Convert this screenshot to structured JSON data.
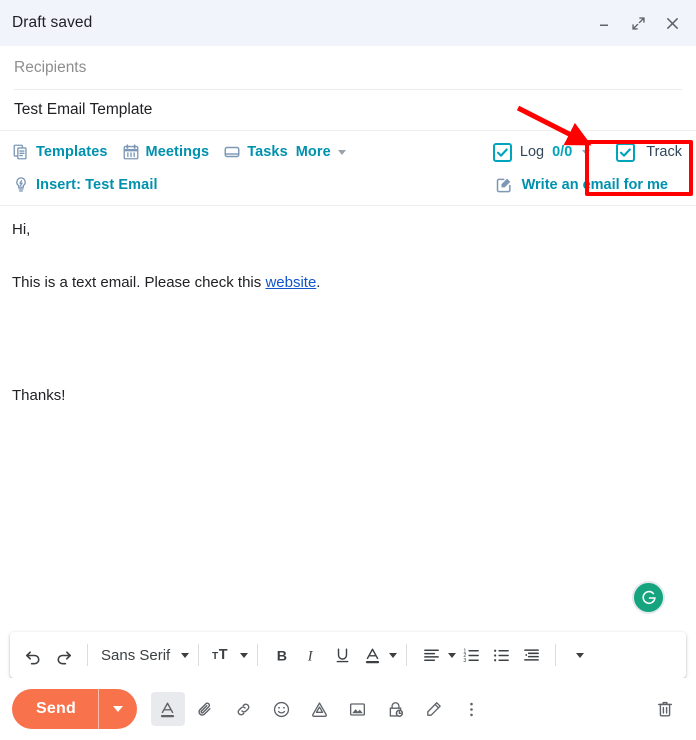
{
  "window": {
    "title": "Draft saved",
    "controls": [
      {
        "name": "minimize",
        "icon": "minimize-icon"
      },
      {
        "name": "fullscreen",
        "icon": "fullscreen-icon"
      },
      {
        "name": "close",
        "icon": "close-icon"
      }
    ]
  },
  "fields": {
    "recipients_placeholder": "Recipients",
    "subject_value": "Test Email Template"
  },
  "plugin_bar": {
    "items": [
      {
        "label": "Templates",
        "icon": "templates-icon"
      },
      {
        "label": "Meetings",
        "icon": "calendar-icon"
      },
      {
        "label": "Tasks",
        "icon": "tasks-icon"
      },
      {
        "label": "More",
        "icon": "chevron-down-icon"
      }
    ],
    "insert": {
      "label": "Insert: Test Email",
      "icon": "lightbulb-icon"
    },
    "log": {
      "label": "Log",
      "count": "0/0",
      "checked": true
    },
    "track": {
      "label": "Track",
      "checked": true
    },
    "write_for_me": {
      "label": "Write an email for me",
      "icon": "compose-square-icon"
    },
    "accent_color": "#0091ae",
    "checkbox_color": "#00a4bd"
  },
  "body": {
    "greeting": "Hi,",
    "sentence_before_link": "This is a text email. Please check this ",
    "link_text": "website",
    "sentence_after_link": ".",
    "closing": "Thanks!",
    "link_color": "#1155cc"
  },
  "grammarly": {
    "name": "grammarly-icon",
    "letter": "G",
    "color": "#15a47e"
  },
  "format_toolbar": {
    "undo": "undo-icon",
    "redo": "redo-icon",
    "font_family": "Sans Serif",
    "font_size": "font-size-icon",
    "bold": "B",
    "italic": "I",
    "underline": "U",
    "text_color": "A",
    "align": "align-left-icon",
    "numbered_list": "numbered-list-icon",
    "bulleted_list": "bulleted-list-icon",
    "indent_less": "indent-less-icon",
    "more": "chevron-down-icon"
  },
  "action_bar": {
    "send_label": "Send",
    "send_color": "#f8724c",
    "icons": [
      {
        "name": "formatting-options-icon",
        "active": true
      },
      {
        "name": "attach-file-icon",
        "active": false
      },
      {
        "name": "insert-link-icon",
        "active": false
      },
      {
        "name": "insert-emoji-icon",
        "active": false
      },
      {
        "name": "insert-drive-icon",
        "active": false
      },
      {
        "name": "insert-photo-icon",
        "active": false
      },
      {
        "name": "confidential-mode-icon",
        "active": false
      },
      {
        "name": "insert-signature-icon",
        "active": false
      },
      {
        "name": "more-options-icon",
        "active": false
      }
    ],
    "discard": "discard-draft-icon"
  },
  "annotations": {
    "highlight_color": "#ff0000",
    "box_target": "Track",
    "arrow": "points-to-track-checkbox"
  }
}
